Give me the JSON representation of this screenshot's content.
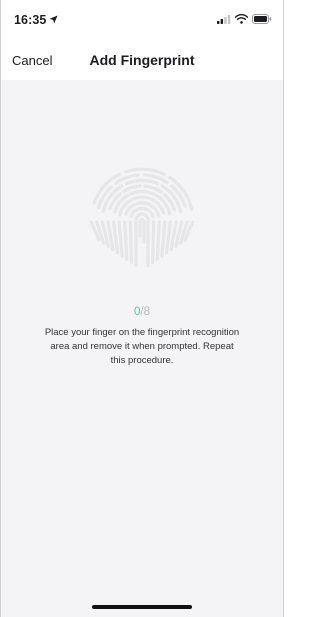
{
  "status_bar": {
    "time": "16:35"
  },
  "nav": {
    "cancel_label": "Cancel",
    "title": "Add Fingerprint"
  },
  "enrollment": {
    "current": "0",
    "separator": "/",
    "total": "8",
    "instruction": "Place your finger on the fingerprint recognition area and remove it when prompted. Repeat this procedure."
  },
  "colors": {
    "accent": "#5fc79a",
    "background": "#f4f4f6",
    "fingerprint": "#e6e6e9"
  },
  "icons": {
    "location": "location-arrow-icon",
    "signal": "cellular-signal-icon",
    "wifi": "wifi-icon",
    "battery": "battery-icon",
    "fingerprint": "fingerprint-icon"
  }
}
